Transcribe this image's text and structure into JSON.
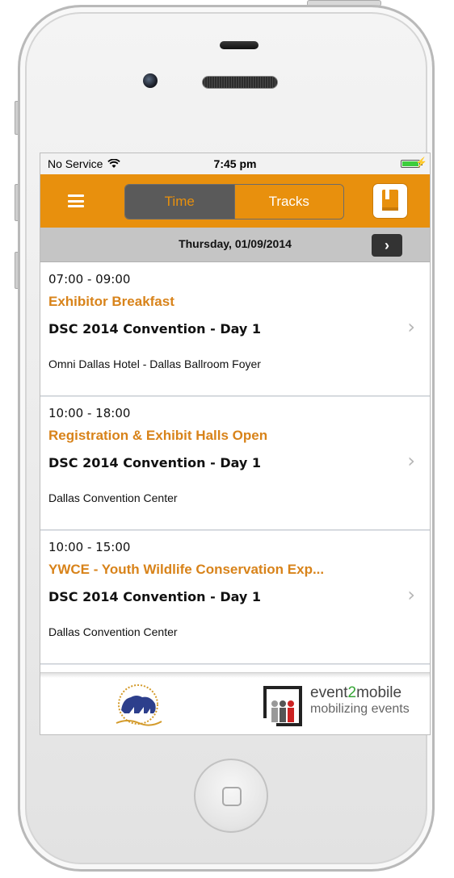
{
  "status": {
    "carrier": "No Service",
    "time": "7:45 pm",
    "wifi_icon": "wifi-icon",
    "battery_icon": "battery-icon"
  },
  "nav": {
    "menu_icon": "hamburger-icon",
    "tabs": [
      {
        "label": "Time",
        "selected": true
      },
      {
        "label": "Tracks",
        "selected": false
      }
    ],
    "bookmark_icon": "bookmark-icon",
    "accent_color": "#e8900d"
  },
  "date": {
    "label": "Thursday,  01/09/2014",
    "next_icon": "chevron-right-icon"
  },
  "sessions": [
    {
      "time": "07:00 - 09:00",
      "title": "Exhibitor Breakfast",
      "day": "DSC 2014 Convention - Day 1",
      "location": "Omni Dallas Hotel - Dallas Ballroom Foyer"
    },
    {
      "time": "10:00 - 18:00",
      "title": "Registration & Exhibit Halls Open",
      "day": "DSC 2014 Convention - Day 1",
      "location": "Dallas Convention Center"
    },
    {
      "time": "10:00 - 15:00",
      "title": "YWCE - Youth Wildlife Conservation Exp...",
      "day": "DSC 2014 Convention - Day 1",
      "location": "Dallas Convention Center"
    }
  ],
  "footer": {
    "brand_pre": "event",
    "brand_num": "2",
    "brand_post": "mobile",
    "tagline": "mobilizing events"
  }
}
